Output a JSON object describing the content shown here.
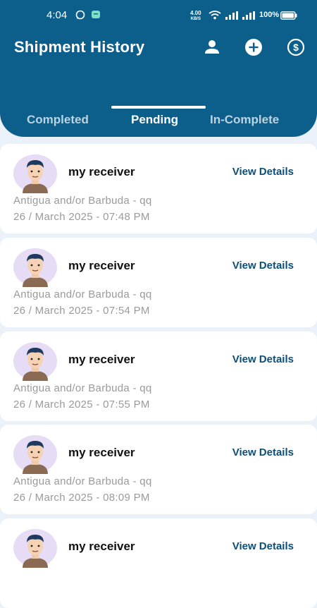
{
  "status_bar": {
    "time": "4:04",
    "net_speed": "4.00",
    "net_unit": "KB/S",
    "battery": "100%"
  },
  "header": {
    "title": "Shipment History",
    "icons": [
      "person-icon",
      "add-circle-icon",
      "dollar-icon"
    ]
  },
  "tabs": [
    {
      "label": "Completed",
      "active": false
    },
    {
      "label": "Pending",
      "active": true
    },
    {
      "label": "In-Complete",
      "active": false
    }
  ],
  "shipments": [
    {
      "receiver": "my receiver",
      "action": "View Details",
      "route": "Antigua and/or Barbuda  -  qq",
      "datetime": "26 / March  2025  -  07:48 PM"
    },
    {
      "receiver": "my receiver",
      "action": "View Details",
      "route": "Antigua and/or Barbuda  -  qq",
      "datetime": "26 / March  2025  -  07:54 PM"
    },
    {
      "receiver": "my receiver",
      "action": "View Details",
      "route": "Antigua and/or Barbuda  -  qq",
      "datetime": "26 / March  2025  -  07:55 PM"
    },
    {
      "receiver": "my receiver",
      "action": "View Details",
      "route": "Antigua and/or Barbuda  -  qq",
      "datetime": "26 / March  2025  -  08:09 PM"
    },
    {
      "receiver": "my receiver",
      "action": "View Details",
      "route": "",
      "datetime": ""
    }
  ],
  "colors": {
    "primary": "#0b5f8a",
    "accent": "#0b4f78",
    "background": "#eaf1f8"
  }
}
